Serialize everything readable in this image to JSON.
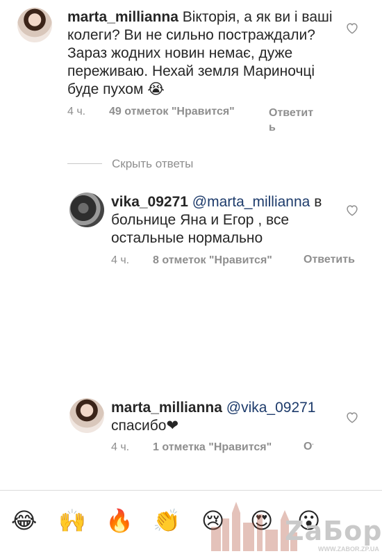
{
  "comments": [
    {
      "username": "marta_millianna",
      "mention": "",
      "text": "Вікторія, а як ви і ваші колеги? Ви не сильно постраждали? Зараз жодних новин немає, дуже переживаю. Нехай земля Мариночці буде пухом 😭",
      "time": "4 ч.",
      "likes": "49 отметок \"Нравится\"",
      "reply": "Ответить"
    },
    {
      "username": "vika_09271",
      "mention": "@marta_millianna",
      "text": "в больнице Яна и Егор , все остальные нормально",
      "time": "4 ч.",
      "likes": "8 отметок \"Нравится\"",
      "reply": "Ответить"
    },
    {
      "username": "marta_millianna",
      "mention": "@vika_09271",
      "text": "спасибо❤",
      "time": "4 ч.",
      "likes": "1 отметка \"Нравится\"",
      "reply": "Ответить"
    }
  ],
  "hide_replies": "Скрыть ответы",
  "emoji_bar": [
    "😂",
    "🙌",
    "🔥",
    "👏",
    "😢",
    "😍",
    "😮"
  ],
  "watermark": {
    "logo": "ZаБор",
    "url": "WWW.ZABOR.ZP.UA"
  }
}
